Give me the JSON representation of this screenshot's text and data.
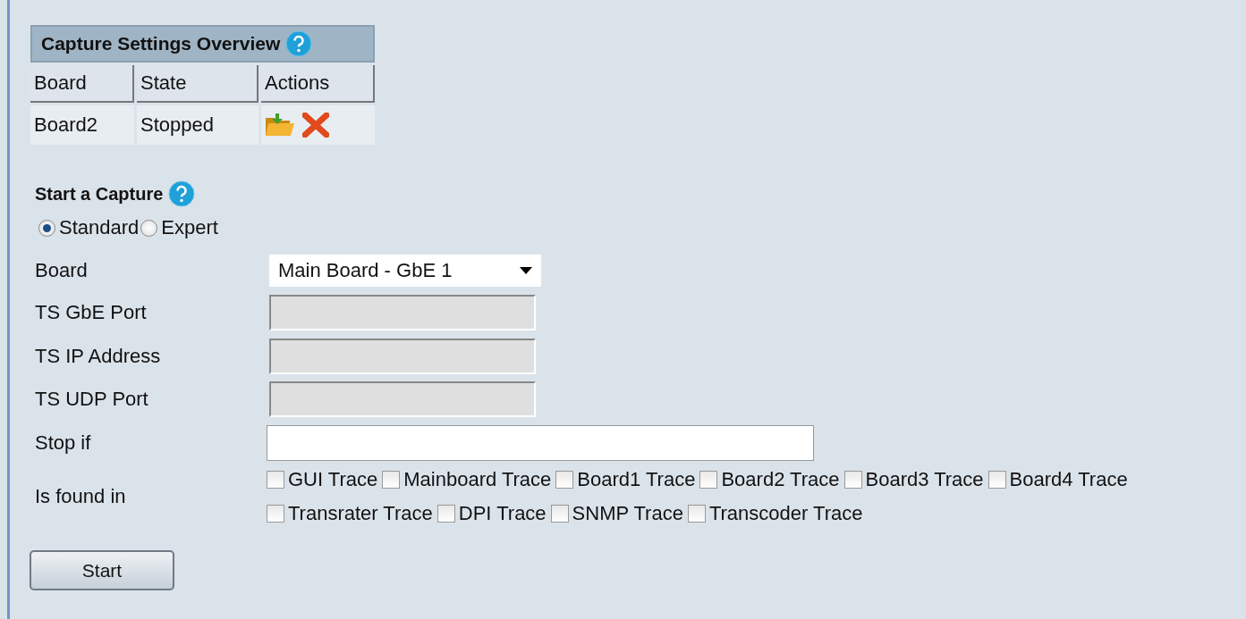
{
  "overview": {
    "title": "Capture Settings Overview",
    "columns": [
      "Board",
      "State",
      "Actions"
    ],
    "rows": [
      {
        "board": "Board2",
        "state": "Stopped"
      }
    ]
  },
  "start_capture": {
    "title": "Start a Capture",
    "modes": [
      {
        "label": "Standard",
        "selected": true
      },
      {
        "label": "Expert",
        "selected": false
      }
    ],
    "fields": [
      {
        "label": "Board",
        "kind": "select",
        "value": "Main Board - GbE 1",
        "disabled": false
      },
      {
        "label": "TS GbE Port",
        "kind": "input",
        "disabled": true
      },
      {
        "label": "TS IP Address",
        "kind": "input",
        "disabled": true
      },
      {
        "label": "TS UDP Port",
        "kind": "input",
        "disabled": true
      },
      {
        "label": "Stop if",
        "kind": "wide",
        "disabled": false
      }
    ],
    "found_in": {
      "label": "Is found in",
      "options": [
        {
          "label": "GUI Trace",
          "checked": false
        },
        {
          "label": "Mainboard Trace",
          "checked": false
        },
        {
          "label": "Board1 Trace",
          "checked": false
        },
        {
          "label": "Board2 Trace",
          "checked": false
        },
        {
          "label": "Board3 Trace",
          "checked": false
        },
        {
          "label": "Board4 Trace",
          "checked": false
        },
        {
          "label": "Transrater Trace",
          "checked": false
        },
        {
          "label": "DPI Trace",
          "checked": false
        },
        {
          "label": "SNMP Trace",
          "checked": false
        },
        {
          "label": "Transcoder Trace",
          "checked": false
        }
      ]
    },
    "button": "Start"
  }
}
